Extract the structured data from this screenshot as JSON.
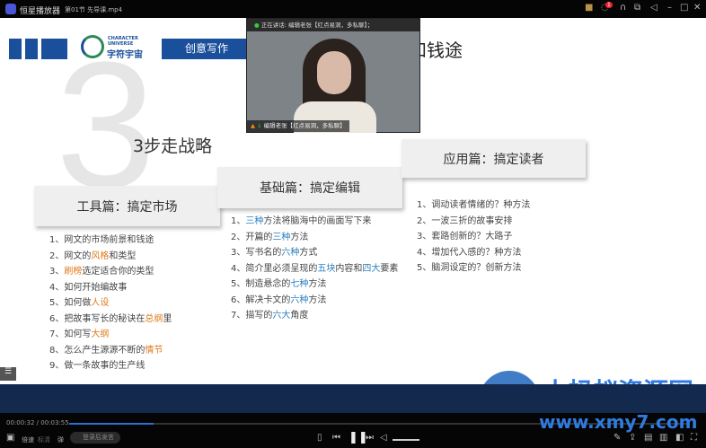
{
  "app": {
    "name": "恒星播放器",
    "file": "第01节 先导课.mp4",
    "notification_count": "1"
  },
  "slide": {
    "logo": {
      "en1": "CHARACTER",
      "en2": "UNIVERSE",
      "cn": "字符宇宙"
    },
    "category": "创意写作",
    "title_visible": "和钱途",
    "big_number": "3",
    "strategy": "3步走战略",
    "sections": [
      {
        "title": "工具篇：搞定市场",
        "items": [
          [
            {
              "t": "1、网文的市场前景和钱途"
            }
          ],
          [
            {
              "t": "2、网文的"
            },
            {
              "t": "风格",
              "h": "o"
            },
            {
              "t": "和类型"
            }
          ],
          [
            {
              "t": "3、"
            },
            {
              "t": "刷榜",
              "h": "o"
            },
            {
              "t": "选定适合你的类型"
            }
          ],
          [
            {
              "t": "4、如何开始编故事"
            }
          ],
          [
            {
              "t": "5、如何做"
            },
            {
              "t": "人设",
              "h": "o"
            }
          ],
          [
            {
              "t": "6、把故事写长的秘诀在"
            },
            {
              "t": "总纲",
              "h": "o"
            },
            {
              "t": "里"
            }
          ],
          [
            {
              "t": "7、如何写"
            },
            {
              "t": "大纲",
              "h": "o"
            }
          ],
          [
            {
              "t": "8、怎么产生源源不断的"
            },
            {
              "t": "情节",
              "h": "o"
            }
          ],
          [
            {
              "t": "9、做一条故事的生产线"
            }
          ]
        ]
      },
      {
        "title": "基础篇：搞定编辑",
        "items": [
          [
            {
              "t": "1、"
            },
            {
              "t": "三种",
              "h": "b"
            },
            {
              "t": "方法将脑海中的画面写下来"
            }
          ],
          [
            {
              "t": "2、开篇的"
            },
            {
              "t": "三种",
              "h": "b"
            },
            {
              "t": "方法"
            }
          ],
          [
            {
              "t": "3、写书名的"
            },
            {
              "t": "六种",
              "h": "b"
            },
            {
              "t": "方式"
            }
          ],
          [
            {
              "t": "4、简介里必须呈现的"
            },
            {
              "t": "五块",
              "h": "b"
            },
            {
              "t": "内容和"
            },
            {
              "t": "四大",
              "h": "b"
            },
            {
              "t": "要素"
            }
          ],
          [
            {
              "t": "5、制造悬念的"
            },
            {
              "t": "七种",
              "h": "b"
            },
            {
              "t": "方法"
            }
          ],
          [
            {
              "t": "6、解决卡文的"
            },
            {
              "t": "六种",
              "h": "b"
            },
            {
              "t": "方法"
            }
          ],
          [
            {
              "t": "7、描写的"
            },
            {
              "t": "六大",
              "h": "b"
            },
            {
              "t": "角度"
            }
          ]
        ]
      },
      {
        "title": "应用篇：搞定读者",
        "items": [
          [
            {
              "t": "1、调动读者情绪的？种方法"
            }
          ],
          [
            {
              "t": "2、一波三折的故事安排"
            }
          ],
          [
            {
              "t": "3、套路创新的？大路子"
            }
          ],
          [
            {
              "t": "4、增加代入感的？种方法"
            }
          ],
          [
            {
              "t": "5、脑洞设定的？创新方法"
            }
          ]
        ]
      }
    ]
  },
  "webcam": {
    "speaking": "正在讲话: 编辑老张【红点易洞，多私聊】；",
    "name": "编辑老张【红点易洞，多私聊】"
  },
  "watermark": {
    "cn": "小蚂蚁资源网",
    "url": "www.xmy7.com"
  },
  "player": {
    "time": "00:00:32 / 00:03:55",
    "progress": 0.136,
    "subtitle_label": "倍速",
    "quality_label": "标清",
    "danmaku_label": "弹",
    "danmaku_placeholder": "登录后发言"
  },
  "colors": {
    "brand_blue": "#1a4f9c",
    "orange": "#e07a1c",
    "blue_hl": "#2a7fc0"
  }
}
